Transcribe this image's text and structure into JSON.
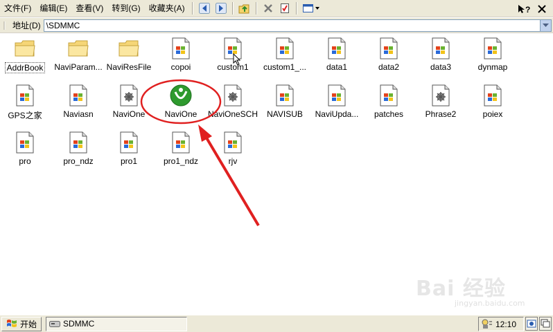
{
  "menubar": {
    "items": [
      "文件(F)",
      "编辑(E)",
      "查看(V)",
      "转到(G)",
      "收藏夹(A)"
    ]
  },
  "toolbar": {
    "icons": [
      "back-arrow-icon",
      "forward-arrow-icon",
      "up-folder-icon",
      "delete-icon",
      "properties-icon",
      "views-icon"
    ]
  },
  "address": {
    "label": "地址(D)",
    "value": "\\SDMMC"
  },
  "files": [
    {
      "name": "AddrBook",
      "type": "folder"
    },
    {
      "name": "NaviParam...",
      "type": "folder"
    },
    {
      "name": "NaviResFile",
      "type": "folder"
    },
    {
      "name": "copoi",
      "type": "doc"
    },
    {
      "name": "custom1",
      "type": "doc"
    },
    {
      "name": "custom1_...",
      "type": "doc"
    },
    {
      "name": "data1",
      "type": "doc"
    },
    {
      "name": "data2",
      "type": "doc"
    },
    {
      "name": "data3",
      "type": "doc"
    },
    {
      "name": "dynmap",
      "type": "doc"
    },
    {
      "name": "GPS之家",
      "type": "doc"
    },
    {
      "name": "Naviasn",
      "type": "doc"
    },
    {
      "name": "NaviOne",
      "type": "gear"
    },
    {
      "name": "NaviOne",
      "type": "app"
    },
    {
      "name": "NaviOneSCH",
      "type": "gear"
    },
    {
      "name": "NAVISUB",
      "type": "doc"
    },
    {
      "name": "NaviUpda...",
      "type": "doc"
    },
    {
      "name": "patches",
      "type": "doc"
    },
    {
      "name": "Phrase2",
      "type": "gear"
    },
    {
      "name": "poiex",
      "type": "doc"
    },
    {
      "name": "pro",
      "type": "doc"
    },
    {
      "name": "pro_ndz",
      "type": "doc"
    },
    {
      "name": "pro1",
      "type": "doc"
    },
    {
      "name": "pro1_ndz",
      "type": "doc"
    },
    {
      "name": "rjv",
      "type": "doc"
    }
  ],
  "taskbar": {
    "start_label": "开始",
    "task_label": "SDMMC",
    "clock": "12:10"
  },
  "watermark": {
    "text": "Bai 经验",
    "sub": "jingyan.baidu.com"
  },
  "colors": {
    "chrome": "#ece9d8",
    "annotation_red": "#e02020",
    "app_green": "#2e9a2e"
  }
}
